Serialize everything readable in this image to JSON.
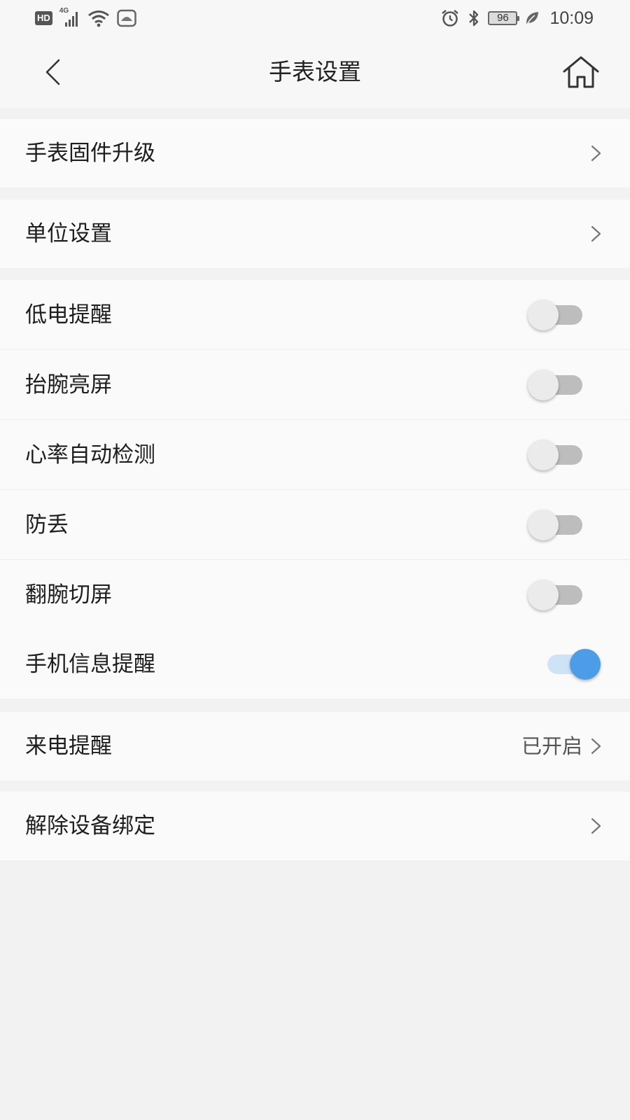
{
  "status_bar": {
    "hd_badge": "HD",
    "network_label": "4G",
    "battery": "96",
    "time": "10:09"
  },
  "header": {
    "title": "手表设置"
  },
  "menu": {
    "firmware_upgrade": "手表固件升级",
    "unit_settings": "单位设置",
    "unbind_device": "解除设备绑定"
  },
  "toggles": [
    {
      "label": "低电提醒",
      "on": false
    },
    {
      "label": "抬腕亮屏",
      "on": false
    },
    {
      "label": "心率自动检测",
      "on": false
    },
    {
      "label": "防丢",
      "on": false
    },
    {
      "label": "翻腕切屏",
      "on": false
    },
    {
      "label": "手机信息提醒",
      "on": true
    }
  ],
  "call_reminder": {
    "label": "来电提醒",
    "value": "已开启"
  },
  "colors": {
    "accent": "#4a9de6",
    "accent_track": "#cfe3f6",
    "off_track": "#bdbdbd",
    "off_knob": "#ebebeb",
    "row_bg": "#fafafa",
    "page_bg": "#f2f2f2"
  },
  "icons": {
    "back": "chevron-left-icon",
    "home": "home-icon",
    "row_arrow": "chevron-right-icon"
  }
}
